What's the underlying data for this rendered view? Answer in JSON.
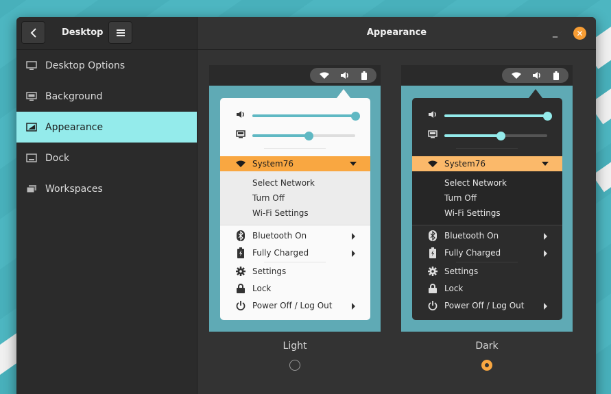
{
  "window": {
    "sidebar_title": "Desktop",
    "main_title": "Appearance",
    "minimize_glyph": "_",
    "close_glyph": "✕"
  },
  "sidebar": {
    "items": [
      {
        "label": "Desktop Options",
        "icon": "monitor-icon"
      },
      {
        "label": "Background",
        "icon": "wallpaper-icon"
      },
      {
        "label": "Appearance",
        "icon": "appearance-icon"
      },
      {
        "label": "Dock",
        "icon": "dock-icon"
      },
      {
        "label": "Workspaces",
        "icon": "workspaces-icon"
      }
    ],
    "active": "Appearance"
  },
  "menu": {
    "network_name": "System76",
    "network_sub": [
      "Select Network",
      "Turn Off",
      "Wi-Fi Settings"
    ],
    "bluetooth": "Bluetooth On",
    "battery": "Fully Charged",
    "settings": "Settings",
    "lock": "Lock",
    "power": "Power Off / Log Out"
  },
  "options": {
    "light_label": "Light",
    "dark_label": "Dark",
    "selected": "Dark"
  },
  "colors": {
    "accent_orange": "#f9a741",
    "accent_cyan": "#94ebeb",
    "slider": "#5fb8c3"
  },
  "sliders": {
    "volume": 1.0,
    "brightness": 0.55
  }
}
